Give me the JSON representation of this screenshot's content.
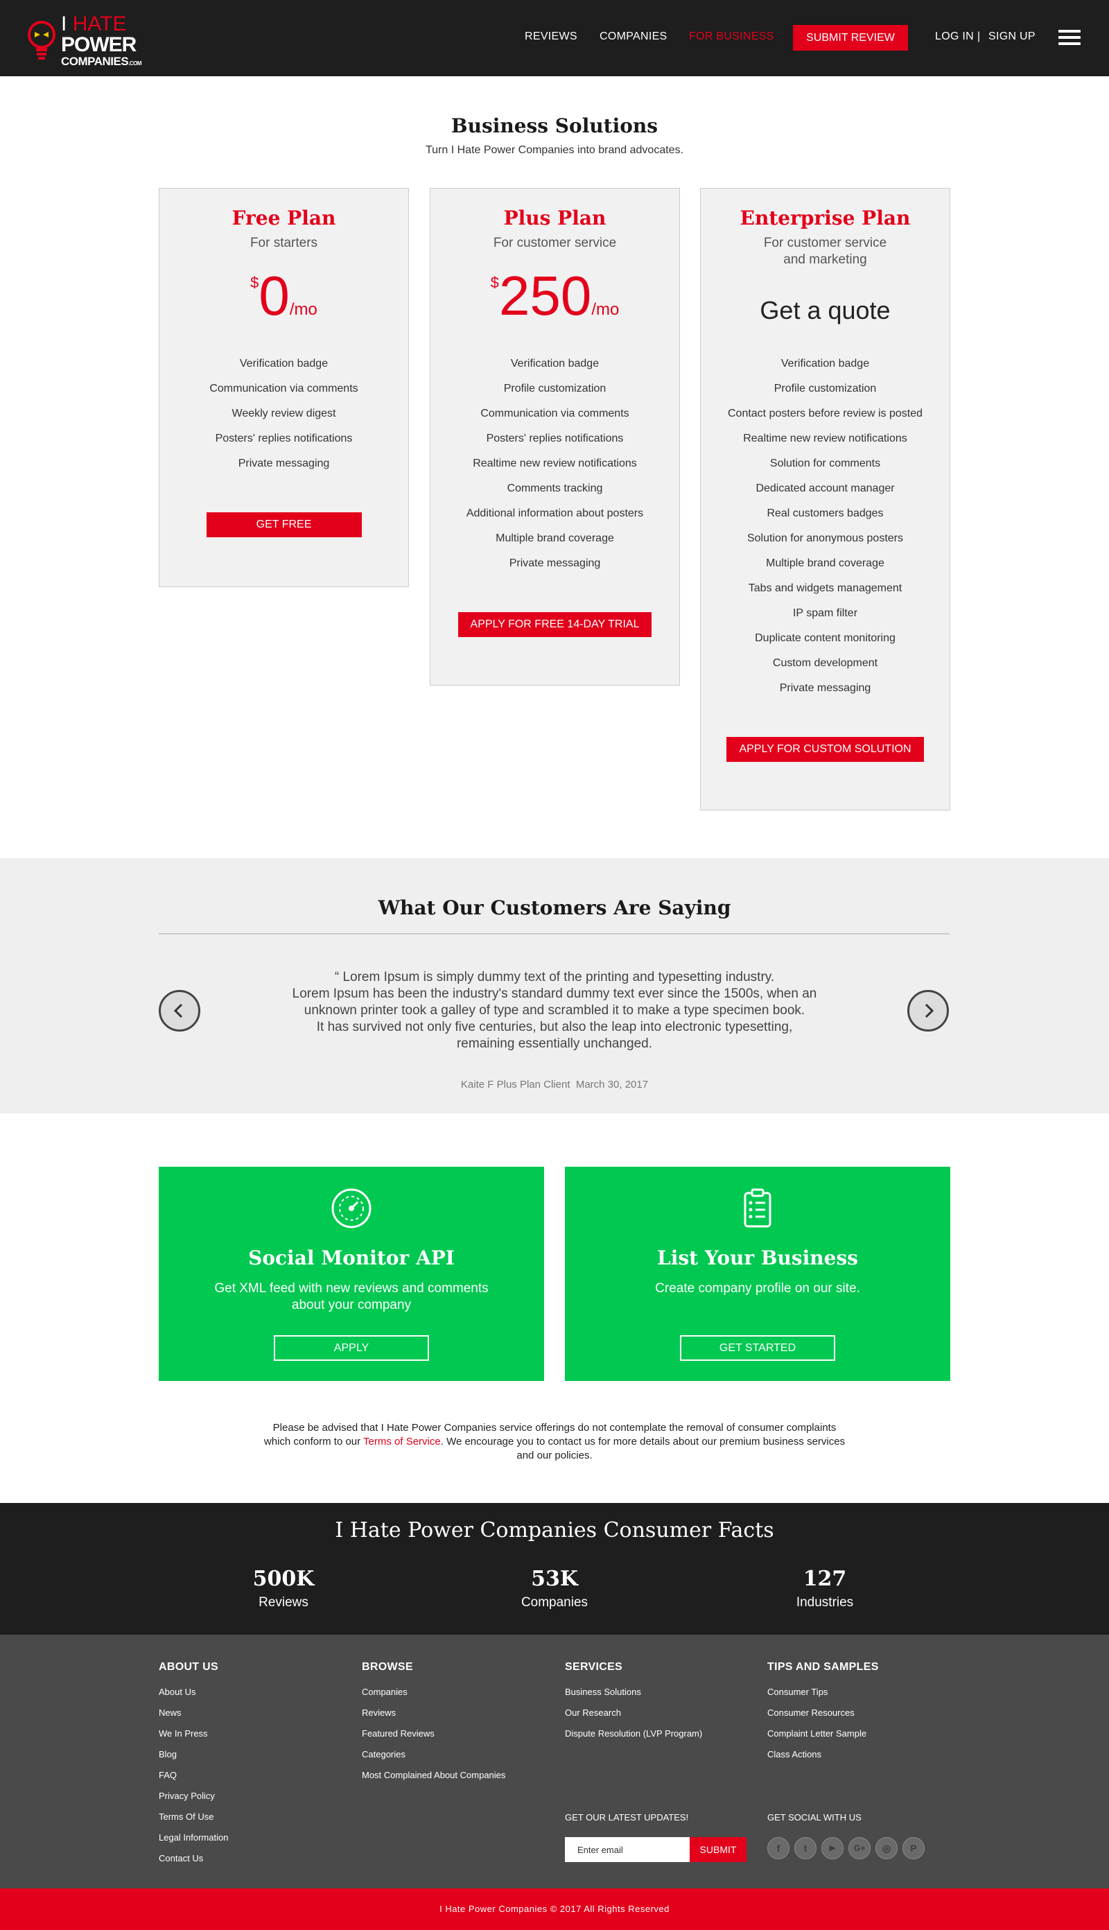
{
  "header": {
    "logo": {
      "line1_a": "I",
      "line1_b": "HATE",
      "line2": "POWER",
      "line3": "COMPANIES",
      "line3_suffix": ".COM"
    },
    "nav": [
      "REVIEWS",
      "COMPANIES",
      "FOR BUSINESS"
    ],
    "submit_review": "SUBMIT REVIEW",
    "login": "LOG IN",
    "separator": "|",
    "signup": "SIGN UP",
    "accent_color": "#e3001b"
  },
  "business": {
    "title": "Business Solutions",
    "subtitle": "Turn I Hate Power Companies into brand advocates."
  },
  "plans": [
    {
      "name": "Free Plan",
      "for": "For starters",
      "currency": "$",
      "price": "0",
      "period": "/mo",
      "features": [
        "Verification badge",
        "Communication via comments",
        "Weekly review digest",
        "Posters' replies notifications",
        "Private messaging"
      ],
      "button": "GET FREE"
    },
    {
      "name": "Plus Plan",
      "for": "For customer service",
      "currency": "$",
      "price": "250",
      "period": "/mo",
      "features": [
        "Verification badge",
        "Profile customization",
        "Communication via comments",
        "Posters' replies notifications",
        "Realtime new review notifications",
        "Comments tracking",
        "Additional information about posters",
        "Multiple brand coverage",
        "Private messaging"
      ],
      "button": "APPLY FOR FREE 14-DAY TRIAL"
    },
    {
      "name": "Enterprise Plan",
      "for_line1": "For customer service",
      "for_line2": "and marketing",
      "quote": "Get a quote",
      "features": [
        "Verification badge",
        "Profile customization",
        "Contact posters before review is posted",
        "Realtime new review notifications",
        "Solution for comments",
        "Dedicated account manager",
        "Real customers badges",
        "Solution for anonymous posters",
        "Multiple brand coverage",
        "Tabs and widgets management",
        "IP spam filter",
        "Duplicate content monitoring",
        "Custom development",
        "Private messaging"
      ],
      "button": "APPLY FOR CUSTOM SOLUTION"
    }
  ],
  "testimonial": {
    "title": "What Our Customers Are Saying",
    "lines": [
      "“ Lorem Ipsum is simply dummy text of the printing and typesetting industry.",
      "Lorem Ipsum has been the industry's standard dummy text ever since the 1500s, when an",
      "unknown printer took a galley of type and scrambled it to make a type specimen book.",
      "It has survived not only five centuries, but also the leap into electronic typesetting,",
      "remaining essentially unchanged."
    ],
    "author": "Kaite F Plus Plan Client",
    "date": "March 30, 2017"
  },
  "cards": [
    {
      "icon": "speedometer-icon",
      "title": "Social Monitor API",
      "text": "Get XML feed with new reviews and comments about your company",
      "button": "APPLY"
    },
    {
      "icon": "clipboard-list-icon",
      "title": "List Your Business",
      "text": "Create company profile on our site.",
      "button": "GET STARTED"
    }
  ],
  "disclaimer": {
    "before": "Please be advised that I Hate Power Companies service offerings do not contemplate the removal of consumer complaints which conform to our ",
    "link": "Terms of Service",
    "after": ". We encourage you to contact us for more details about our premium business services and our policies."
  },
  "facts": {
    "title": "I Hate Power Companies Consumer Facts",
    "items": [
      {
        "num": "500K",
        "label": "Reviews"
      },
      {
        "num": "53K",
        "label": "Companies"
      },
      {
        "num": "127",
        "label": "Industries"
      }
    ]
  },
  "footer": {
    "columns": [
      {
        "title": "ABOUT US",
        "links": [
          "About Us",
          "News",
          "We In Press",
          "Blog",
          "FAQ",
          "Privacy Policy",
          "Terms Of Use",
          "Legal Information",
          "Contact Us"
        ]
      },
      {
        "title": "BROWSE",
        "links": [
          "Companies",
          "Reviews",
          "Featured Reviews",
          "Categories",
          "Most Complained About Companies"
        ]
      },
      {
        "title": "SERVICES",
        "links": [
          "Business Solutions",
          "Our Research",
          "Dispute Resolution (LVP Program)"
        ]
      },
      {
        "title": "TIPS AND SAMPLES",
        "links": [
          "Consumer Tips",
          "Consumer Resources",
          "Complaint Letter Sample",
          "Class Actions"
        ]
      }
    ],
    "updates_label": "GET OUR LATEST UPDATES!",
    "email_placeholder": "Enter email",
    "submit": "SUBMIT",
    "social_label": "GET SOCIAL WITH US",
    "social": [
      {
        "icon": "facebook-icon",
        "glyph": "f"
      },
      {
        "icon": "twitter-icon",
        "glyph": "t"
      },
      {
        "icon": "youtube-icon",
        "glyph": "▶"
      },
      {
        "icon": "google-plus-icon",
        "glyph": "G+"
      },
      {
        "icon": "instagram-icon",
        "glyph": "◎"
      },
      {
        "icon": "pinterest-icon",
        "glyph": "P"
      }
    ],
    "copyright": "I Hate Power Companies © 2017 All Rights Reserved"
  }
}
